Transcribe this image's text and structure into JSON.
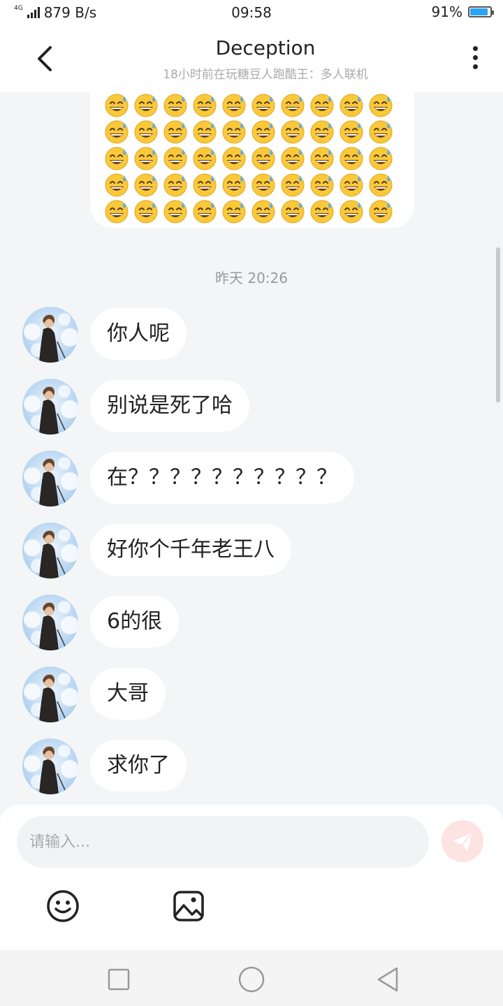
{
  "status_bar": {
    "network_type": "4G",
    "speed": "879 B/s",
    "time": "09:58",
    "battery": "91%",
    "battery_level": 0.91
  },
  "header": {
    "title": "Deception",
    "subtitle": "18小时前在玩糖豆人跑酷王：多人联机"
  },
  "chat": {
    "emoji_message": {
      "emoji": "sweat-smile-emoji",
      "rows": 5,
      "columns": 10
    },
    "timestamp": "昨天 20:26",
    "messages": [
      {
        "text": "你人呢"
      },
      {
        "text": "别说是死了哈"
      },
      {
        "text": "在？？？？？？？？？？"
      },
      {
        "text": "好你个千年老王八"
      },
      {
        "text": "6的很"
      },
      {
        "text": "大哥"
      },
      {
        "text": "求你了"
      }
    ]
  },
  "composer": {
    "placeholder": "请输入...",
    "value": ""
  },
  "icons": {
    "back": "chevron-left-icon",
    "more": "more-vertical-icon",
    "send": "send-icon",
    "emoji": "smiley-icon",
    "image": "image-icon",
    "nav_recent": "square-icon",
    "nav_home": "circle-icon",
    "nav_back": "triangle-back-icon"
  },
  "colors": {
    "accent_battery": "#2aa4f4",
    "send_disabled": "#fde3e1",
    "background": "#f4f5f7"
  }
}
